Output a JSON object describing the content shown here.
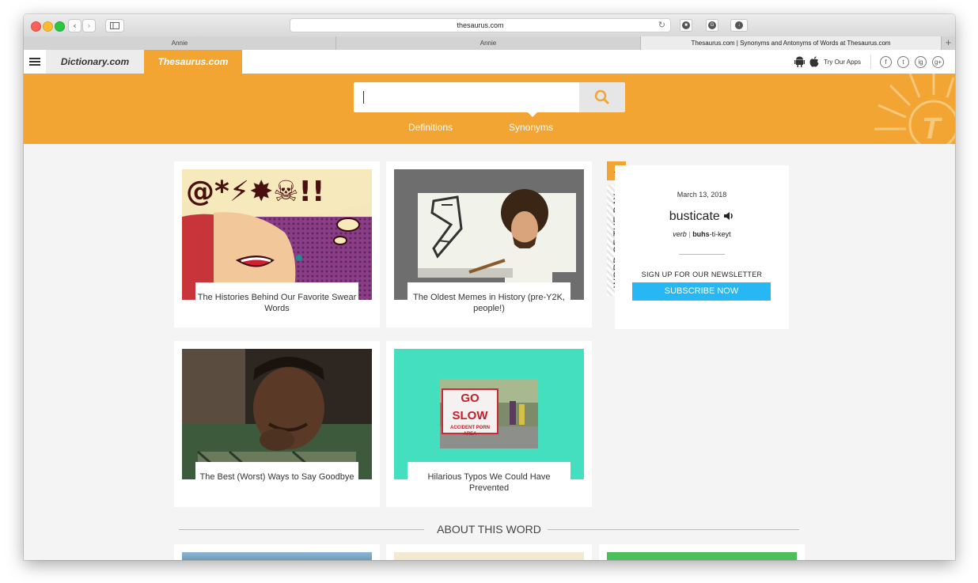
{
  "browser": {
    "url": "thesaurus.com",
    "tabs": [
      {
        "label": "Annie"
      },
      {
        "label": "Annie"
      },
      {
        "label": "Thesaurus.com | Synonyms and Antonyms of Words at Thesaurus.com"
      }
    ]
  },
  "sitenav": {
    "dictionary": "Dictionary.com",
    "thesaurus": "Thesaurus.com",
    "try_apps": "Try Our Apps",
    "social": [
      "f",
      "t",
      "ig",
      "g+"
    ]
  },
  "search": {
    "value": "",
    "tabs": [
      "Definitions",
      "Synonyms"
    ]
  },
  "cards": [
    {
      "caption": "The Histories Behind Our Favorite Swear Words",
      "image": "pop-art-woman-swearing"
    },
    {
      "caption": "The Oldest Memes in History (pre-Y2K, people!)",
      "image": "painter-meme"
    },
    {
      "caption": "The Best (Worst) Ways to Say Goodbye",
      "image": "thinking-man"
    },
    {
      "caption": "Hilarious Typos We Could Have Prevented",
      "image": "go-slow-sign",
      "sign_line1": "GO SLOW",
      "sign_line2": "ACCIDENT PORN AREA"
    }
  ],
  "wotd": {
    "label": "WORD OF THE DAY",
    "date": "March 13, 2018",
    "word": "busticate",
    "pos": "verb",
    "pron_stressed": "buhs",
    "pron_rest": "-ti-keyt",
    "newsletter": "SIGN UP FOR OUR NEWSLETTER",
    "subscribe": "SUBSCRIBE NOW"
  },
  "about": {
    "heading": "ABOUT THIS WORD"
  },
  "colors": {
    "brand_orange": "#f2a533",
    "subscribe_blue": "#27b7f5",
    "teal": "#44dfbf"
  }
}
